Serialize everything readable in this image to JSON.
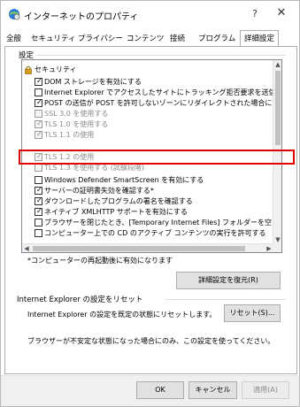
{
  "window": {
    "title": "インターネットのプロパティ",
    "help": "?",
    "close": "✕"
  },
  "tabs": [
    {
      "label": "全般"
    },
    {
      "label": "セキュリティ"
    },
    {
      "label": "プライバシー"
    },
    {
      "label": "コンテンツ"
    },
    {
      "label": "接続"
    },
    {
      "label": "プログラム"
    },
    {
      "label": "詳細設定",
      "active": true
    }
  ],
  "settings": {
    "group_label": "設定",
    "category": "セキュリティ",
    "items": [
      {
        "label": "DOM ストレージを有効にする",
        "checked": true,
        "enabled": true
      },
      {
        "label": "Internet Explorer でアクセスしたサイトにトラッキング拒否要求を送信す",
        "checked": false,
        "enabled": true
      },
      {
        "label": "POST の送信が POST を許可しないゾーンにリダイレクトされた場合に警",
        "checked": true,
        "enabled": true
      },
      {
        "label": "SSL 3.0 を使用する",
        "checked": false,
        "enabled": false
      },
      {
        "label": "TLS 1.0 を使用する",
        "checked": true,
        "enabled": false
      },
      {
        "label": "TLS 1.1 の使用",
        "checked": true,
        "enabled": false
      },
      {
        "label": "TLS 1.2 の使用",
        "checked": true,
        "enabled": false
      },
      {
        "label": "TLS 1.3 を使用する (試験段階)",
        "checked": false,
        "enabled": false
      },
      {
        "label": "Windows Defender SmartScreen を有効にする",
        "checked": false,
        "enabled": true
      },
      {
        "label": "サーバーの証明書失効を確認する*",
        "checked": true,
        "enabled": true
      },
      {
        "label": "ダウンロードしたプログラムの署名を確認する",
        "checked": true,
        "enabled": true
      },
      {
        "label": "ネイティブ XMLHTTP サポートを有効にする",
        "checked": true,
        "enabled": true
      },
      {
        "label": "ブラウザーを閉じたとき、[Temporary Internet Files] フォルダーを空に",
        "checked": false,
        "enabled": true
      },
      {
        "label": "コンピューター上での CD のアクティブ コンテンツの実行を許可する",
        "checked": false,
        "enabled": true
      }
    ],
    "restart_note": "*コンピューターの再起動後に有効になります",
    "restore_button": "詳細設定を復元(R)"
  },
  "reset": {
    "group_label": "Internet Explorer の設定をリセット",
    "description": "Internet Explorer の設定を既定の状態にリセットします。",
    "button": "リセット(S)...",
    "warning": "ブラウザーが不安定な状態になった場合にのみ、この設定を使ってください。"
  },
  "footer": {
    "ok": "OK",
    "cancel": "キャンセル",
    "apply": "適用(A)"
  },
  "scroll_arrows": {
    "up": "▲",
    "down": "▼",
    "left": "◀",
    "right": "▶"
  },
  "colors": {
    "highlight": "#e30000",
    "lock": "#d89a1c",
    "disabled_text": "#8a8a8a"
  }
}
